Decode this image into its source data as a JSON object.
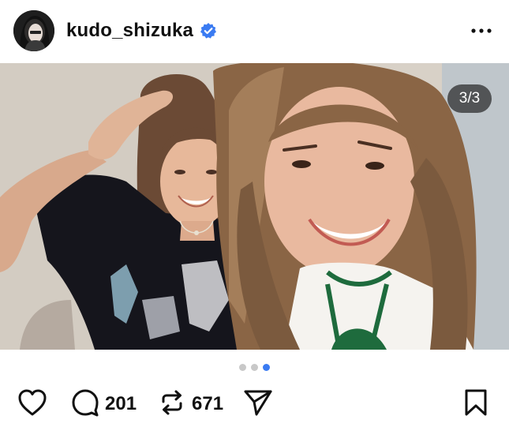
{
  "post": {
    "username": "kudo_shizuka",
    "verified": true,
    "avatar_icon": "profile-avatar",
    "more_icon": "more-options-icon"
  },
  "media": {
    "counter": "3/3",
    "current_index": 3,
    "total": 3
  },
  "actions": {
    "like_icon": "heart-icon",
    "comment_icon": "comment-icon",
    "comment_count": "201",
    "repost_icon": "repost-icon",
    "repost_count": "671",
    "share_icon": "send-icon",
    "save_icon": "bookmark-icon"
  },
  "colors": {
    "verified_badge": "#3a7bf2",
    "active_dot": "#3a7bf2",
    "inactive_dot": "#c8c8c8",
    "text": "#111111"
  }
}
